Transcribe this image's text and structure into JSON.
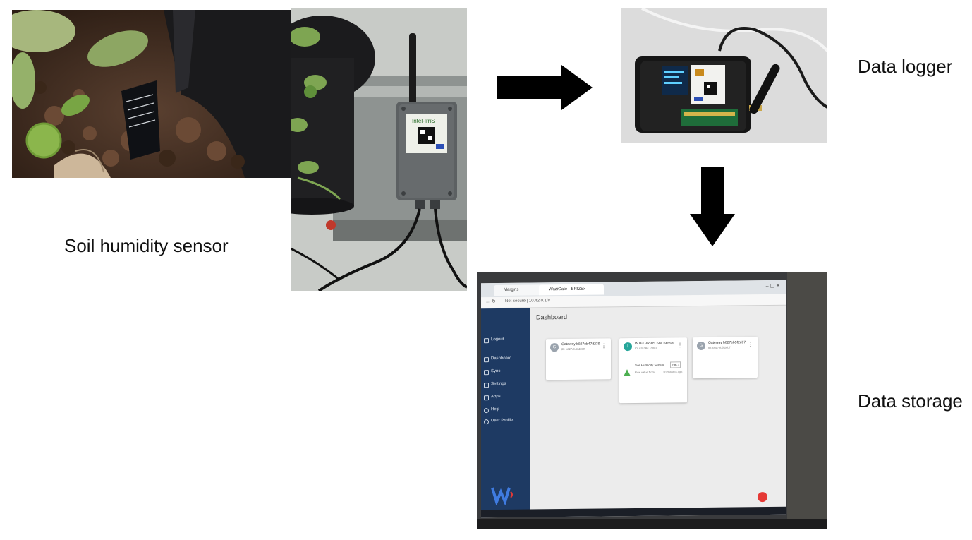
{
  "labels": {
    "sensor": "Soil humidity sensor",
    "logger": "Data logger",
    "storage": "Data storage"
  },
  "screen": {
    "tabs": [
      "Margins",
      "WaziGate - BRIZEx"
    ],
    "url": "Not secure | 10.42.0.1/#",
    "title": "Dashboard",
    "sidebar": [
      "Logout",
      "Dashboard",
      "Sync",
      "Settings",
      "Apps",
      "Help",
      "User Profile"
    ],
    "cards": [
      {
        "avatar": "G",
        "title": "Gateway b827eb47d239",
        "sub": "ID: b827eb47d239"
      },
      {
        "avatar": "I",
        "title": "INTEL-IRRIS Soil Sensor",
        "sub": "ID: 62c38d...0007..."
      },
      {
        "avatar": "G",
        "title": "Gateway b827eb5f2eb7",
        "sub": "ID: b827eb5f2eb7"
      }
    ],
    "sensor_card": {
      "name": "Soil Humidity Sensor",
      "value": "796.3",
      "caption": "Raw value from",
      "age": "30 minutes ago"
    }
  },
  "device": {
    "brand": "Intel-IrriS"
  },
  "colors": {
    "arrow": "#000000",
    "sidebar": "#1e3a63",
    "accent": "#e53935"
  }
}
